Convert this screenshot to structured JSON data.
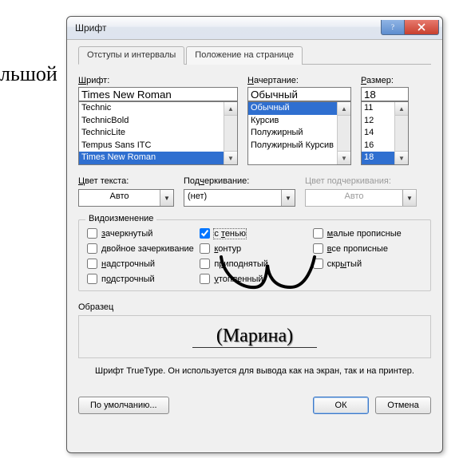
{
  "bg_text": "льшой",
  "window": {
    "title": "Шрифт",
    "tabs": [
      "Отступы и интервалы",
      "Положение на странице"
    ],
    "active_tab": 0
  },
  "font": {
    "label": "Шрифт:",
    "value": "Times New Roman",
    "list": [
      "Technic",
      "TechnicBold",
      "TechnicLite",
      "Tempus Sans ITC",
      "Times New Roman"
    ],
    "selected_index": 4
  },
  "style": {
    "label": "Начертание:",
    "value": "Обычный",
    "list": [
      "Обычный",
      "Курсив",
      "Полужирный",
      "Полужирный Курсив"
    ],
    "selected_index": 0
  },
  "size": {
    "label": "Размер:",
    "value": "18",
    "list": [
      "11",
      "12",
      "14",
      "16",
      "18"
    ],
    "selected_index": 4
  },
  "color": {
    "label": "Цвет текста:",
    "value": "Авто",
    "underline_char": "Ц"
  },
  "underline": {
    "label": "Подчеркивание:",
    "value": "(нет)",
    "underline_char": "ч"
  },
  "ul_color": {
    "label": "Цвет подчеркивания:",
    "value": "Авто"
  },
  "effects": {
    "legend": "Видоизменение",
    "items": [
      {
        "key": "strike",
        "label": "зачеркнутый",
        "checked": false,
        "ul": "з"
      },
      {
        "key": "shadow",
        "label": "с тенью",
        "checked": true,
        "ul": "т",
        "focused": true
      },
      {
        "key": "smallcaps",
        "label": "малые прописные",
        "checked": false,
        "ul": "м"
      },
      {
        "key": "dstrike",
        "label": "двойное зачеркивание",
        "checked": false,
        "ul": "д"
      },
      {
        "key": "outline",
        "label": "контур",
        "checked": false,
        "ul": "к"
      },
      {
        "key": "allcaps",
        "label": "все прописные",
        "checked": false,
        "ul": "в"
      },
      {
        "key": "superscript",
        "label": "надстрочный",
        "checked": false,
        "ul": "н"
      },
      {
        "key": "emboss",
        "label": "приподнятый",
        "checked": false,
        "ul": "р"
      },
      {
        "key": "hidden",
        "label": "скрытый",
        "checked": false,
        "ul": "ы"
      },
      {
        "key": "subscript",
        "label": "подстрочный",
        "checked": false,
        "ul": "о"
      },
      {
        "key": "engrave",
        "label": "утопленный",
        "checked": false,
        "ul": "у"
      }
    ]
  },
  "sample": {
    "label": "Образец",
    "text": "(Марина)"
  },
  "info": "Шрифт TrueType. Он используется для вывода как на экран, так и на принтер.",
  "buttons": {
    "defaults": "По умолчанию...",
    "ok": "ОК",
    "cancel": "Отмена"
  }
}
